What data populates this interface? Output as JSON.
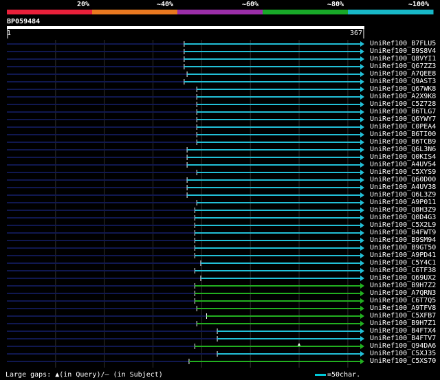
{
  "colors": {
    "background": "#000000",
    "identity_bands": [
      "#e8203a",
      "#e87820",
      "#9a2ea8",
      "#18a828",
      "#18b8c8"
    ],
    "query_bar": "#ffffff",
    "unaligned": "#101850",
    "hit_cyan": "#22c0d8",
    "hit_green": "#22b020",
    "grid": "#303030"
  },
  "identity_legend": [
    "20%",
    "~40%",
    "~60%",
    "~80%",
    "~100%"
  ],
  "query": {
    "id": "BP059484",
    "start": "1",
    "end": "367",
    "length": 367
  },
  "hits": [
    {
      "name": "UniRef100_B7FLU5",
      "start": 182,
      "end": 367,
      "color": "cyan"
    },
    {
      "name": "UniRef100_B9S8V4",
      "start": 182,
      "end": 367,
      "color": "cyan"
    },
    {
      "name": "UniRef100_Q8VYI1",
      "start": 182,
      "end": 367,
      "color": "cyan"
    },
    {
      "name": "UniRef100_Q67ZZ3",
      "start": 182,
      "end": 367,
      "color": "cyan"
    },
    {
      "name": "UniRef100_A7QEE8",
      "start": 185,
      "end": 367,
      "color": "cyan"
    },
    {
      "name": "UniRef100_Q9ASТ3",
      "start": 182,
      "end": 367,
      "color": "cyan"
    },
    {
      "name": "UniRef100_Q67WK8",
      "start": 195,
      "end": 367,
      "color": "cyan"
    },
    {
      "name": "UniRef100_A2X9K8",
      "start": 195,
      "end": 367,
      "color": "cyan"
    },
    {
      "name": "UniRef100_C5Z728",
      "start": 195,
      "end": 367,
      "color": "cyan"
    },
    {
      "name": "UniRef100_B6TLG7",
      "start": 195,
      "end": 367,
      "color": "cyan"
    },
    {
      "name": "UniRef100_Q6YWY7",
      "start": 195,
      "end": 367,
      "color": "cyan"
    },
    {
      "name": "UniRef100_C0PEA4",
      "start": 195,
      "end": 367,
      "color": "cyan"
    },
    {
      "name": "UniRef100_B6TI00",
      "start": 195,
      "end": 367,
      "color": "cyan"
    },
    {
      "name": "UniRef100_B6TCB9",
      "start": 195,
      "end": 367,
      "color": "cyan"
    },
    {
      "name": "UniRef100_Q6L3N6",
      "start": 185,
      "end": 367,
      "color": "cyan"
    },
    {
      "name": "UniRef100_Q0KIS4",
      "start": 185,
      "end": 367,
      "color": "cyan"
    },
    {
      "name": "UniRef100_A4UV54",
      "start": 185,
      "end": 367,
      "color": "cyan"
    },
    {
      "name": "UniRef100_C5XYS9",
      "start": 195,
      "end": 367,
      "color": "cyan"
    },
    {
      "name": "UniRef100_Q60D00",
      "start": 185,
      "end": 367,
      "color": "cyan"
    },
    {
      "name": "UniRef100_A4UV38",
      "start": 185,
      "end": 367,
      "color": "cyan"
    },
    {
      "name": "UniRef100_Q6L3Z9",
      "start": 185,
      "end": 367,
      "color": "cyan"
    },
    {
      "name": "UniRef100_A9P011",
      "start": 195,
      "end": 367,
      "color": "cyan"
    },
    {
      "name": "UniRef100_Q8H3Z9",
      "start": 193,
      "end": 367,
      "color": "cyan"
    },
    {
      "name": "UniRef100_Q0D4G3",
      "start": 193,
      "end": 367,
      "color": "cyan"
    },
    {
      "name": "UniRef100_C5X2L9",
      "start": 193,
      "end": 367,
      "color": "cyan"
    },
    {
      "name": "UniRef100_B4FWT9",
      "start": 193,
      "end": 367,
      "color": "cyan"
    },
    {
      "name": "UniRef100_B9SM94",
      "start": 193,
      "end": 367,
      "color": "cyan"
    },
    {
      "name": "UniRef100_B9GT50",
      "start": 193,
      "end": 367,
      "color": "cyan"
    },
    {
      "name": "UniRef100_A9PD41",
      "start": 193,
      "end": 367,
      "color": "cyan"
    },
    {
      "name": "UniRef100_C5Y4C1",
      "start": 199,
      "end": 367,
      "color": "cyan"
    },
    {
      "name": "UniRef100_C6TF38",
      "start": 193,
      "end": 367,
      "color": "cyan"
    },
    {
      "name": "UniRef100_Q69UX2",
      "start": 199,
      "end": 367,
      "color": "cyan"
    },
    {
      "name": "UniRef100_B9H7Z2",
      "start": 193,
      "end": 367,
      "color": "green"
    },
    {
      "name": "UniRef100_A7QRN3",
      "start": 193,
      "end": 367,
      "color": "green"
    },
    {
      "name": "UniRef100_C6T7Q5",
      "start": 193,
      "end": 367,
      "color": "green"
    },
    {
      "name": "UniRef100_A9TFV8",
      "start": 195,
      "end": 367,
      "color": "green"
    },
    {
      "name": "UniRef100_C5XFB7",
      "start": 205,
      "end": 367,
      "color": "green"
    },
    {
      "name": "UniRef100_B9H7Z1",
      "start": 195,
      "end": 367,
      "color": "green"
    },
    {
      "name": "UniRef100_B4FTX4",
      "start": 216,
      "end": 367,
      "color": "cyan"
    },
    {
      "name": "UniRef100_B4FTV7",
      "start": 216,
      "end": 367,
      "color": "cyan"
    },
    {
      "name": "UniRef100_Q94DA6",
      "start": 193,
      "end": 367,
      "color": "green",
      "gap_marker": 300
    },
    {
      "name": "UniRef100_C5XJ35",
      "start": 216,
      "end": 367,
      "color": "cyan"
    },
    {
      "name": "UniRef100_C5XS70",
      "start": 187,
      "end": 367,
      "color": "green"
    }
  ],
  "footer": {
    "legend_text": "Large gaps: ▲(in Query)/— (in Subject)",
    "scale_text": "=50char."
  }
}
